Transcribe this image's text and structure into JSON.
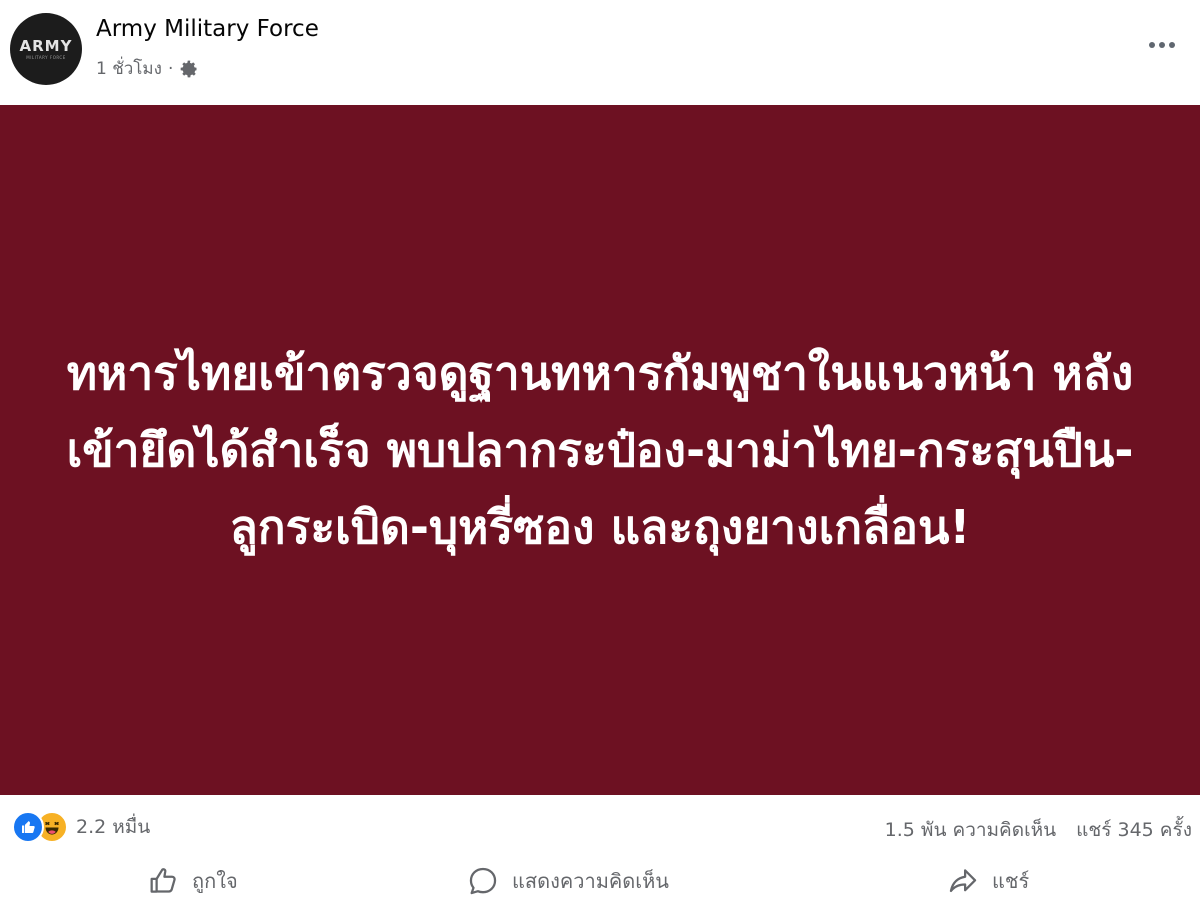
{
  "header": {
    "page_name": "Army Military Force",
    "timestamp": "1 ชั่วโมง",
    "separator": "·",
    "avatar_logo": "ARMY",
    "avatar_sub": "MILITARY FORCE",
    "privacy_icon": "gear-icon",
    "more_icon": "more-dots-icon"
  },
  "post": {
    "background_color": "#6d1122",
    "text": "ทหารไทยเข้าตรวจดูฐานทหารกัมพูชาในแนวหน้า หลังเข้ายึดได้สำเร็จ พบปลากระป๋อง-มาม่าไทย-กระสุนปืน-ลูกระเบิด-บุหรี่ซอง และถุงยางเกลื่อน!"
  },
  "stats": {
    "reaction_icons": [
      "like-reaction-icon",
      "haha-reaction-icon"
    ],
    "reaction_count": "2.2 หมื่น",
    "comments": "1.5 พัน ความคิดเห็น",
    "shares": "แชร์ 345 ครั้ง"
  },
  "actions": {
    "like_label": "ถูกใจ",
    "comment_label": "แสดงความคิดเห็น",
    "share_label": "แชร์"
  }
}
